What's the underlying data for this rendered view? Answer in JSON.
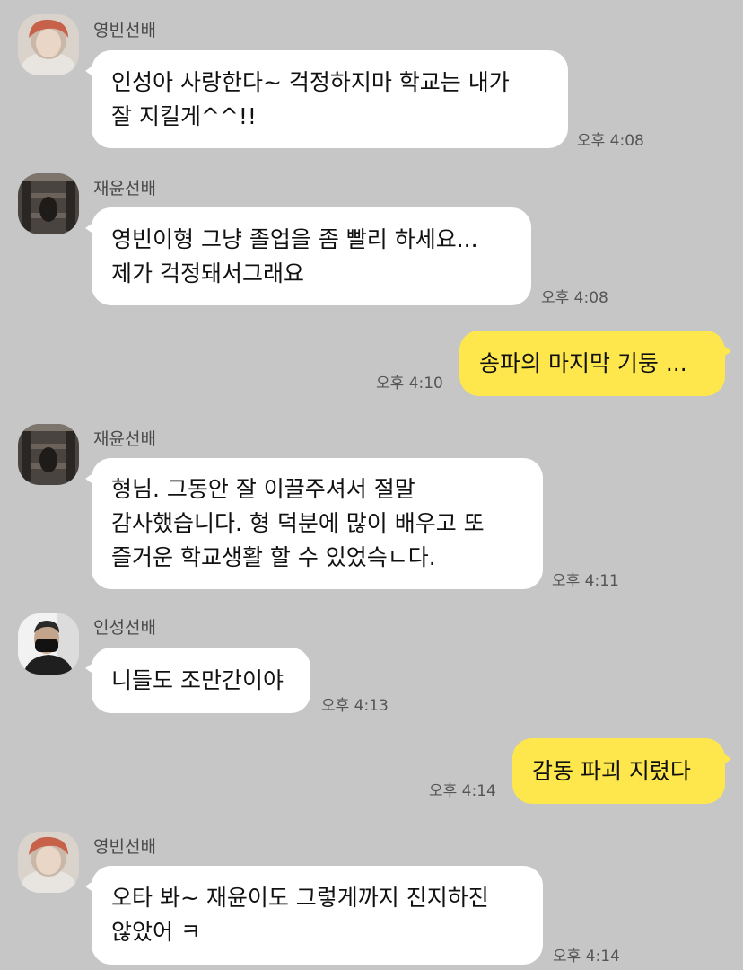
{
  "messages": [
    {
      "sender": "영빈선배",
      "lines": [
        "인성아 사랑한다~ 걱정하지마 학교는 내가",
        "잘 지킬게^^!!"
      ],
      "time": "오후 4:08"
    },
    {
      "sender": "재윤선배",
      "lines": [
        "영빈이형 그냥 졸업을 좀 빨리 하세요...",
        "제가 걱정돼서그래요"
      ],
      "time": "오후 4:08"
    },
    {
      "sender": "me",
      "lines": [
        "송파의 마지막 기둥 ..."
      ],
      "time": "오후 4:10"
    },
    {
      "sender": "재윤선배",
      "lines": [
        "형님. 그동안 잘 이끌주셔서 절말",
        "감사했습니다. 형 덕분에 많이 배우고 또",
        "즐거운 학교생활 할 수 있었슥ㄴ다."
      ],
      "time": "오후 4:11"
    },
    {
      "sender": "인성선배",
      "lines": [
        "니들도 조만간이야"
      ],
      "time": "오후 4:13"
    },
    {
      "sender": "me",
      "lines": [
        "감동 파괴 지렸다"
      ],
      "time": "오후 4:14"
    },
    {
      "sender": "영빈선배",
      "lines": [
        "오타 봐~ 재윤이도 그렇게까지 진지하진",
        "않았어 ㅋ"
      ],
      "time": "오후 4:14"
    }
  ],
  "colors": {
    "background": "#c6c6c6",
    "my_bubble": "#fde74c",
    "their_bubble": "#ffffff"
  }
}
